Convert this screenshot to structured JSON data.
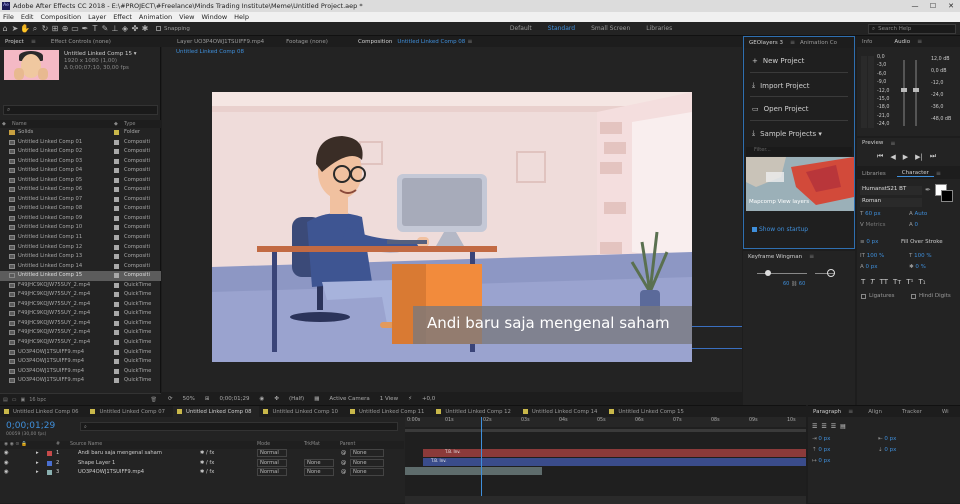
{
  "window": {
    "title": "Adobe After Effects CC 2018 - E:\\#PROJECT\\#Freelance\\Minds Trading Institute\\Meme\\Untitled Project.aep *",
    "app_badge": "Ae"
  },
  "menu": [
    "File",
    "Edit",
    "Composition",
    "Layer",
    "Effect",
    "Animation",
    "View",
    "Window",
    "Help"
  ],
  "toolbar": {
    "snapping": "Snapping",
    "workspaces": [
      {
        "label": "Default",
        "active": false
      },
      {
        "label": "Standard",
        "active": true
      },
      {
        "label": "Small Screen",
        "active": false
      },
      {
        "label": "Libraries",
        "active": false
      }
    ],
    "search_placeholder": "Search Help"
  },
  "project": {
    "tabs": [
      {
        "label": "Project",
        "active": true
      },
      {
        "label": "Effect Controls (none)",
        "active": false
      }
    ],
    "selected": {
      "name": "Untitled Linked Comp 15 ▾",
      "size": "1920 x 1080 (1,00)",
      "duration": "Δ 0;00;07;10, 30,00 fps"
    },
    "search_placeholder": "",
    "columns": {
      "name": "Name",
      "type": "Type"
    },
    "items": [
      {
        "name": "Solids",
        "type": "Folder",
        "folder": true,
        "label": "yellow"
      },
      {
        "name": "Untitled Linked Comp 01",
        "type": "Compositi"
      },
      {
        "name": "Untitled Linked Comp 02",
        "type": "Compositi"
      },
      {
        "name": "Untitled Linked Comp 03",
        "type": "Compositi"
      },
      {
        "name": "Untitled Linked Comp 04",
        "type": "Compositi"
      },
      {
        "name": "Untitled Linked Comp 05",
        "type": "Compositi"
      },
      {
        "name": "Untitled Linked Comp 06",
        "type": "Compositi"
      },
      {
        "name": "Untitled Linked Comp 07",
        "type": "Compositi"
      },
      {
        "name": "Untitled Linked Comp 08",
        "type": "Compositi"
      },
      {
        "name": "Untitled Linked Comp 09",
        "type": "Compositi"
      },
      {
        "name": "Untitled Linked Comp 10",
        "type": "Compositi"
      },
      {
        "name": "Untitled Linked Comp 11",
        "type": "Compositi"
      },
      {
        "name": "Untitled Linked Comp 12",
        "type": "Compositi"
      },
      {
        "name": "Untitled Linked Comp 13",
        "type": "Compositi"
      },
      {
        "name": "Untitled Linked Comp 14",
        "type": "Compositi"
      },
      {
        "name": "Untitled Linked Comp 15",
        "type": "Compositi",
        "selected": true
      },
      {
        "name": "F49JHC9KQJW75SUY_2.mp4",
        "type": "QuickTime"
      },
      {
        "name": "F49JHC9KQJW75SUY_2.mp4",
        "type": "QuickTime"
      },
      {
        "name": "F49JHC9KQJW75SUY_2.mp4",
        "type": "QuickTime"
      },
      {
        "name": "F49JHC9KQJW75SUY_2.mp4",
        "type": "QuickTime"
      },
      {
        "name": "F49JHC9KQJW75SUY_2.mp4",
        "type": "QuickTime"
      },
      {
        "name": "F49JHC9KQJW75SUY_2.mp4",
        "type": "QuickTime"
      },
      {
        "name": "F49JHC9KQJW75SUY_2.mp4",
        "type": "QuickTime"
      },
      {
        "name": "UO3P4OWJ1TSUIFF9.mp4",
        "type": "QuickTime"
      },
      {
        "name": "UO3P4OWJ1TSUIFF9.mp4",
        "type": "QuickTime"
      },
      {
        "name": "UO3P4OWJ1TSUIFF9.mp4",
        "type": "QuickTime"
      },
      {
        "name": "UO3P4OWJ1TSUIFF9.mp4",
        "type": "QuickTime"
      }
    ],
    "footer": "16 bpc"
  },
  "viewer": {
    "tabs": [
      {
        "label": "Layer  UO3P4OWJ1TSUIFF9.mp4",
        "active": false
      },
      {
        "label": "Footage  (none)",
        "active": false
      },
      {
        "label": "Composition",
        "active": true
      }
    ],
    "active_comp": "Untitled Linked Comp 08",
    "subtab": "Untitled Linked Comp 08",
    "caption": "Andi baru saja mengenal saham",
    "bottom": {
      "zoom": "50%",
      "timecode": "0;00;01;29",
      "resolution": "(Half)",
      "camera": "Active Camera",
      "views": "1 View",
      "exposure": "+0,0"
    }
  },
  "geolayers": {
    "tabs": [
      {
        "label": "GEOlayers 3",
        "active": true
      },
      {
        "label": "Animation Co",
        "active": false
      }
    ],
    "buttons": [
      {
        "icon": "+",
        "label": "New Project"
      },
      {
        "icon": "⤓",
        "label": "Import Project"
      },
      {
        "icon": "▭",
        "label": "Open Project"
      },
      {
        "icon": "⤓",
        "label": "Sample Projects ▾"
      }
    ],
    "filter_placeholder": "Filter...",
    "map_caption": "Mapcomp View layers",
    "show_on_startup": "Show on startup"
  },
  "info": {
    "tabs": [
      {
        "label": "Info",
        "active": false
      },
      {
        "label": "Audio",
        "active": true
      }
    ],
    "left": [
      "0,0",
      "-3,0",
      "-6,0",
      "-9,0",
      "-12,0",
      "-15,0",
      "-18,0",
      "-21,0",
      "-24,0"
    ],
    "right": [
      "12,0 dB",
      "0,0 dB",
      "-12,0",
      "-24,0",
      "-36,0",
      "-48,0 dB"
    ]
  },
  "preview": {
    "title": "Preview"
  },
  "character": {
    "tabs": [
      {
        "label": "Libraries",
        "active": false
      },
      {
        "label": "Character",
        "active": true
      }
    ],
    "font": "HumanstS21 BT",
    "style": "Roman",
    "size": "60 px",
    "leading": "Auto",
    "tracking_metrics": "Metrics",
    "kerning": "0",
    "stroke": "0 px",
    "stroke_type": "Fill Over Stroke",
    "v_scale": "100 %",
    "h_scale": "100 %",
    "baseline": "0 px",
    "tsume": "0 %",
    "ligatures": "Ligatures",
    "hindi": "Hindi Digits"
  },
  "keyframe": {
    "title": "Keyframe Wingman",
    "val1": "60",
    "val2": "60"
  },
  "timeline": {
    "tabs": [
      {
        "label": "Untitled Linked Comp 06",
        "active": false
      },
      {
        "label": "Untitled Linked Comp 07",
        "active": false
      },
      {
        "label": "Untitled Linked Comp 08",
        "active": true
      },
      {
        "label": "Untitled Linked Comp 10",
        "active": false
      },
      {
        "label": "Untitled Linked Comp 11",
        "active": false
      },
      {
        "label": "Untitled Linked Comp 12",
        "active": false
      },
      {
        "label": "Untitled Linked Comp 14",
        "active": false
      },
      {
        "label": "Untitled Linked Comp 15",
        "active": false
      }
    ],
    "timecode": "0;00;01;29",
    "timecode_sub": "00059 (30,00 fps)",
    "columns": {
      "source": "Source Name",
      "mode": "Mode",
      "trkmat": "TrkMat",
      "parent": "Parent"
    },
    "layers": [
      {
        "num": "1",
        "name": "Andi baru saja mengenal saham",
        "mode": "Normal",
        "trkmat": "",
        "parent": "None",
        "label": "#c74a4a"
      },
      {
        "num": "2",
        "name": "Shape Layer 1",
        "mode": "Normal",
        "trkmat": "None",
        "parent": "None",
        "label": "#4a6fd0"
      },
      {
        "num": "3",
        "name": "UO3P4OWJ1TSUIFF9.mp4",
        "mode": "Normal",
        "trkmat": "None",
        "parent": "None",
        "label": "#8ab0b0"
      }
    ],
    "ruler": [
      "0:00s",
      "01s",
      "02s",
      "03s",
      "04s",
      "05s",
      "06s",
      "07s",
      "08s",
      "09s",
      "10s"
    ],
    "bar_labels": [
      "T.B. Inv.",
      "T.B. Inv."
    ],
    "playhead_fraction": 0.19
  },
  "paragraph": {
    "tabs": [
      {
        "label": "Paragraph",
        "active": true
      },
      {
        "label": "Align",
        "active": false
      },
      {
        "label": "Tracker",
        "active": false
      },
      {
        "label": "Wi",
        "active": false
      }
    ],
    "v1": "0 px",
    "v2": "0 px",
    "v3": "0 px",
    "v4": "0 px",
    "v5": "0 px"
  }
}
